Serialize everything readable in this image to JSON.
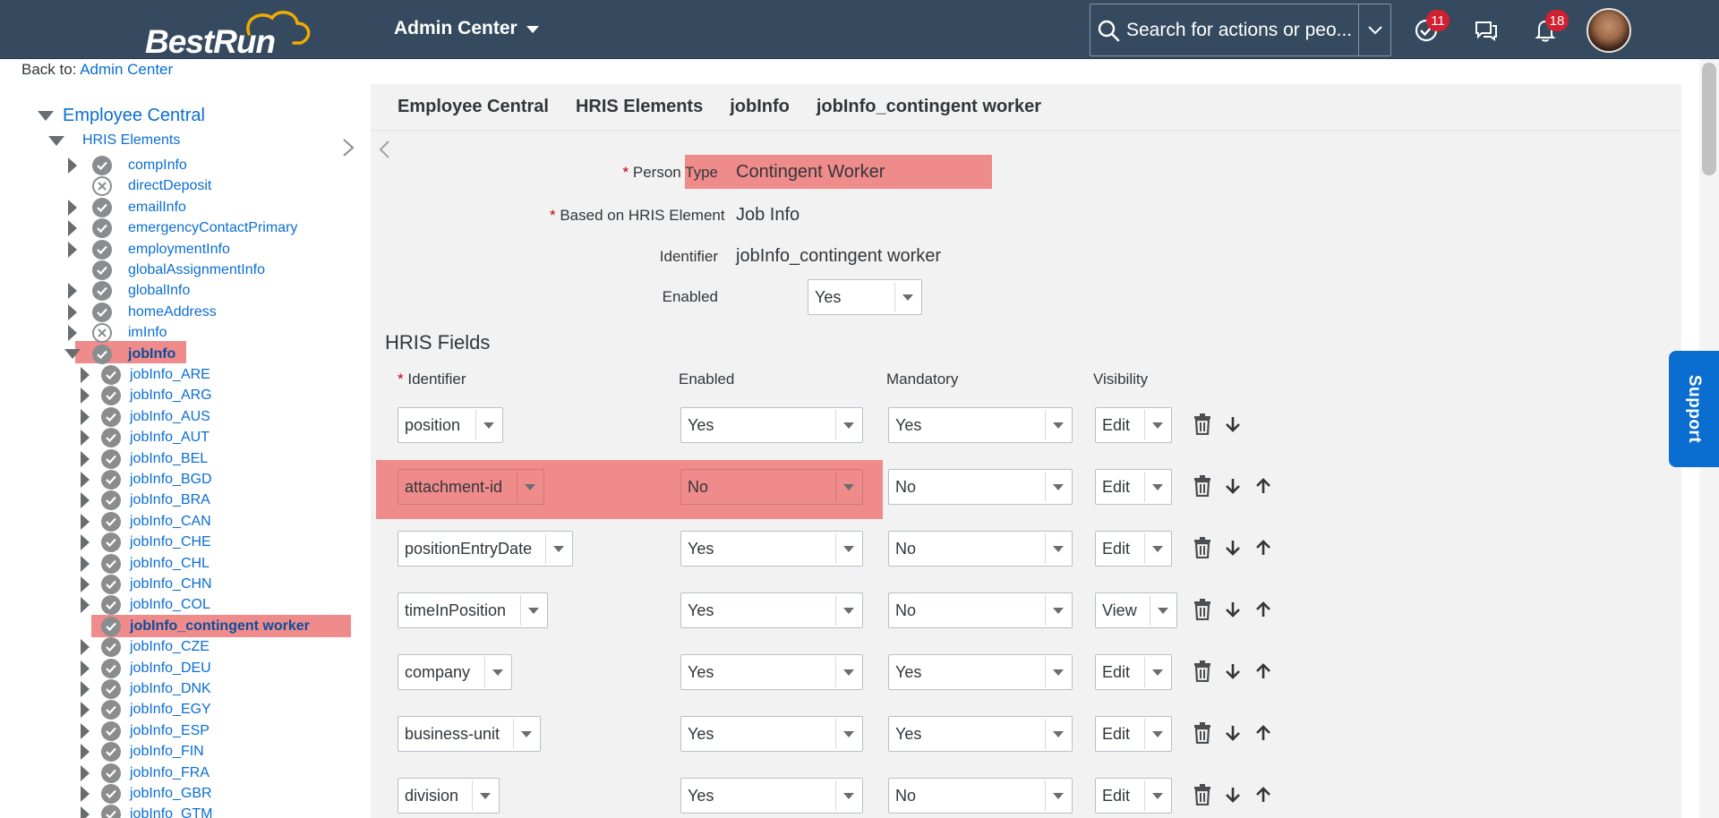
{
  "shell": {
    "logo_best": "Best",
    "logo_run": "Run",
    "app_title": "Admin Center",
    "search_placeholder": "Search for actions or peo...",
    "todo_badge": "11",
    "notif_badge": "18"
  },
  "back": {
    "label": "Back to:",
    "link": "Admin Center"
  },
  "tree": {
    "root": "Employee Central",
    "group": "HRIS Elements",
    "items": [
      {
        "label": "compInfo",
        "status": "ok",
        "expandable": true
      },
      {
        "label": "directDeposit",
        "status": "x",
        "expandable": false
      },
      {
        "label": "emailInfo",
        "status": "ok",
        "expandable": true
      },
      {
        "label": "emergencyContactPrimary",
        "status": "ok",
        "expandable": true
      },
      {
        "label": "employmentInfo",
        "status": "ok",
        "expandable": true
      },
      {
        "label": "globalAssignmentInfo",
        "status": "ok",
        "expandable": false
      },
      {
        "label": "globalInfo",
        "status": "ok",
        "expandable": true
      },
      {
        "label": "homeAddress",
        "status": "ok",
        "expandable": true
      },
      {
        "label": "imInfo",
        "status": "x",
        "expandable": true
      },
      {
        "label": "jobInfo",
        "status": "ok",
        "expandable": true
      }
    ],
    "children": [
      "jobInfo_ARE",
      "jobInfo_ARG",
      "jobInfo_AUS",
      "jobInfo_AUT",
      "jobInfo_BEL",
      "jobInfo_BGD",
      "jobInfo_BRA",
      "jobInfo_CAN",
      "jobInfo_CHE",
      "jobInfo_CHL",
      "jobInfo_CHN",
      "jobInfo_COL",
      "jobInfo_contingent worker",
      "jobInfo_CZE",
      "jobInfo_DEU",
      "jobInfo_DNK",
      "jobInfo_EGY",
      "jobInfo_ESP",
      "jobInfo_FIN",
      "jobInfo_FRA",
      "jobInfo_GBR",
      "jobInfo_GTM"
    ]
  },
  "breadcrumb": [
    "Employee Central",
    "HRIS Elements",
    "jobInfo",
    "jobInfo_contingent worker"
  ],
  "form": {
    "person_type_label": "Person Type",
    "person_type_value": "Contingent Worker",
    "based_on_label": "Based on HRIS Element",
    "based_on_value": "Job Info",
    "identifier_label": "Identifier",
    "identifier_value": "jobInfo_contingent worker",
    "enabled_label": "Enabled",
    "enabled_value": "Yes"
  },
  "hris": {
    "title": "HRIS Fields",
    "headers": {
      "identifier": "Identifier",
      "enabled": "Enabled",
      "mandatory": "Mandatory",
      "visibility": "Visibility"
    },
    "rows": [
      {
        "identifier": "position",
        "enabled": "Yes",
        "mandatory": "Yes",
        "visibility": "Edit"
      },
      {
        "identifier": "attachment-id",
        "enabled": "No",
        "mandatory": "No",
        "visibility": "Edit"
      },
      {
        "identifier": "positionEntryDate",
        "enabled": "Yes",
        "mandatory": "No",
        "visibility": "Edit"
      },
      {
        "identifier": "timeInPosition",
        "enabled": "Yes",
        "mandatory": "No",
        "visibility": "View"
      },
      {
        "identifier": "company",
        "enabled": "Yes",
        "mandatory": "Yes",
        "visibility": "Edit"
      },
      {
        "identifier": "business-unit",
        "enabled": "Yes",
        "mandatory": "Yes",
        "visibility": "Edit"
      },
      {
        "identifier": "division",
        "enabled": "Yes",
        "mandatory": "No",
        "visibility": "Edit"
      }
    ]
  },
  "support_label": "Support",
  "colors": {
    "shell": "#354a5f",
    "link": "#0a6ed1",
    "highlight": "#f08b8b",
    "badge": "#d32030"
  }
}
